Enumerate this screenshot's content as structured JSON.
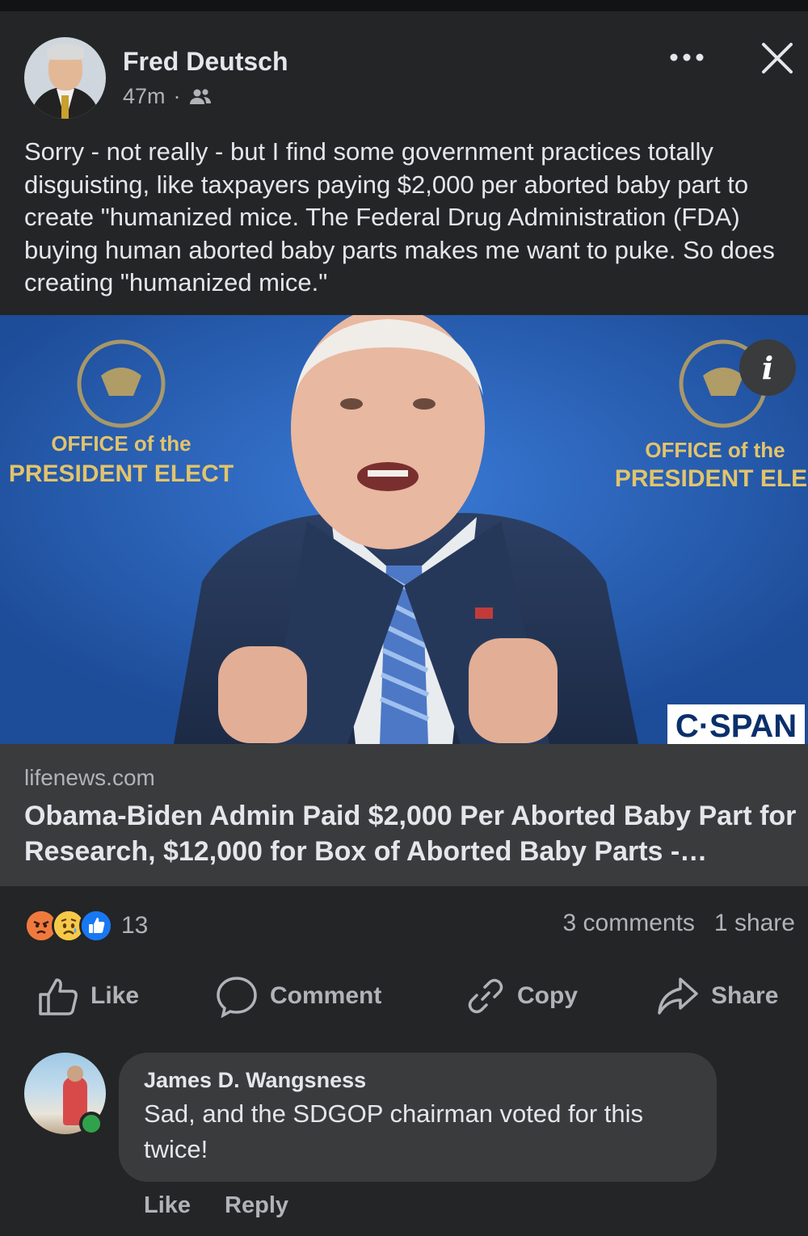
{
  "post": {
    "author": "Fred Deutsch",
    "time": "47m",
    "separator": "·",
    "audience_icon": "friends-icon",
    "text": "Sorry - not really - but I find some government practices totally disguisting, like taxpayers paying $2,000 per aborted baby part to create \"humanized mice. The Federal Drug Administration (FDA) buying human aborted baby parts makes me want to puke. So does creating \"humanized mice.\""
  },
  "media": {
    "backdrop_left_line1": "OFFICE of the",
    "backdrop_left_line2": "PRESIDENT ELECT",
    "backdrop_right_line1": "OFFICE of the",
    "backdrop_right_line2": "PRESIDENT ELECT",
    "watermark": "C·SPAN",
    "info_label": "i"
  },
  "link": {
    "domain": "lifenews.com",
    "headline": "Obama-Biden Admin Paid $2,000 Per Aborted Baby Part for Research, $12,000 for Box of Aborted Baby Parts - LifeNews.com"
  },
  "stats": {
    "reaction_icons": [
      "angry-icon",
      "sad-icon",
      "like-icon"
    ],
    "reaction_count": "13",
    "comments": "3 comments",
    "shares": "1 share"
  },
  "actions": {
    "like": "Like",
    "comment": "Comment",
    "copy": "Copy",
    "share": "Share"
  },
  "comment": {
    "author": "James D. Wangsness",
    "text": "Sad, and the SDGOP chairman voted for this twice!",
    "like": "Like",
    "reply": "Reply"
  },
  "colors": {
    "background": "#242526",
    "card": "#3a3b3c",
    "text_primary": "#e4e6eb",
    "text_secondary": "#b0b3b8",
    "like_blue": "#1877f2",
    "online_green": "#31a24c"
  }
}
